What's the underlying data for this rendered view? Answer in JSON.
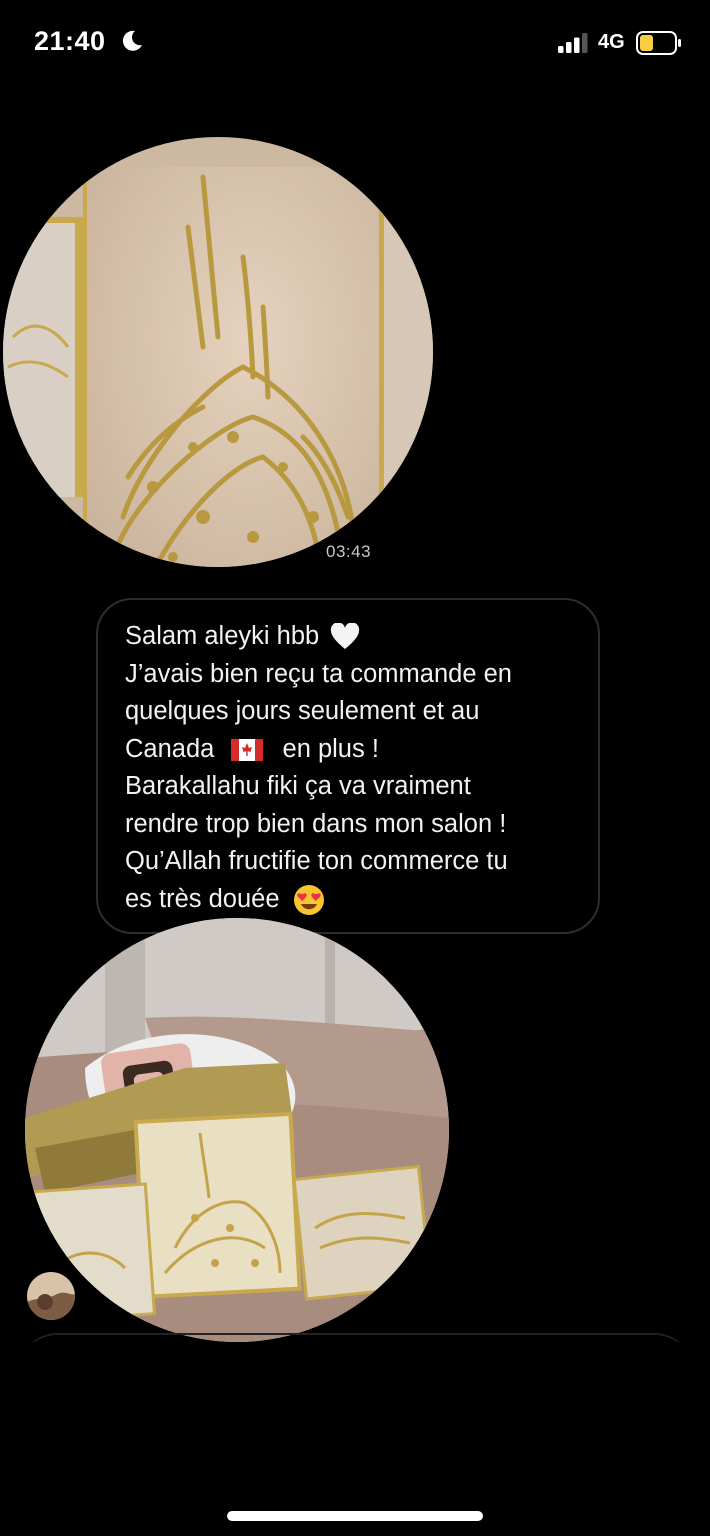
{
  "status_bar": {
    "time": "21:40",
    "network": "4G",
    "focus_icon": "moon-icon",
    "signal_icon": "signal-bars-icon",
    "battery_icon": "battery-low-icon",
    "battery_color": "#f7ce46"
  },
  "messages": [
    {
      "type": "video",
      "timestamp": "03:43"
    },
    {
      "type": "text",
      "lines": [
        "Salam aleyki hbb",
        "J’avais bien reçu ta commande en",
        "quelques jours seulement et au",
        "Canada",
        "en plus !",
        "Barakallahu fiki ça va vraiment",
        "rendre trop bien dans mon salon !",
        "Qu’Allah fructifie ton commerce tu",
        "es très douée"
      ],
      "emojis": [
        "white-heart-emoji",
        "canada-flag-emoji",
        "heart-eyes-emoji"
      ]
    },
    {
      "type": "video"
    }
  ],
  "colors": {
    "background": "#000000",
    "bubble_border": "#2d2d2d",
    "gold": "#c9a94e"
  }
}
